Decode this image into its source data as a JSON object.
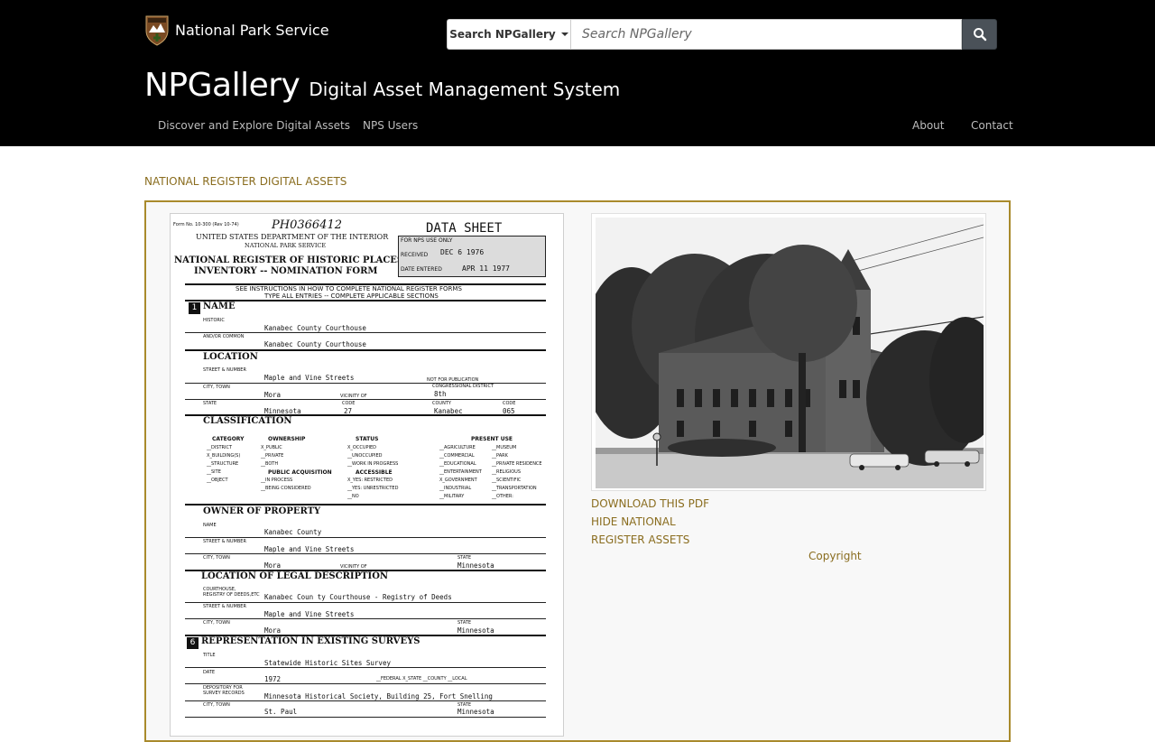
{
  "brand": {
    "name": "National Park Service",
    "logo_icon": "nps-arrowhead-icon"
  },
  "search": {
    "dropdown_label": "Search NPGallery",
    "placeholder": "Search NPGallery",
    "button_icon": "search-icon"
  },
  "site": {
    "title": "NPGallery",
    "subtitle": "Digital Asset Management System"
  },
  "nav": {
    "left": [
      "Discover and Explore Digital Assets",
      "NPS Users"
    ],
    "right": [
      "About",
      "Contact"
    ]
  },
  "breadcrumb": "NATIONAL REGISTER DIGITAL ASSETS",
  "document": {
    "form_no": "Form No. 10-300 (Rev 10-74)",
    "handwritten_id": "PH0366412",
    "data_sheet": "DATA SHEET",
    "dept": "UNITED STATES DEPARTMENT OF THE INTERIOR",
    "service": "NATIONAL PARK SERVICE",
    "form_title_1": "NATIONAL REGISTER OF HISTORIC PLACES",
    "form_title_2": "INVENTORY -- NOMINATION FORM",
    "nps_use": "FOR NPS USE ONLY",
    "received_label": "RECEIVED",
    "received_value": "DEC 6 1976",
    "entered_label": "DATE ENTERED",
    "entered_value": "APR 11 1977",
    "instructions_1": "SEE INSTRUCTIONS IN HOW TO COMPLETE NATIONAL REGISTER FORMS",
    "instructions_2": "TYPE ALL ENTRIES -- COMPLETE APPLICABLE SECTIONS",
    "s1_num": "1",
    "s1_title": "NAME",
    "historic_label": "HISTORIC",
    "historic_value": "Kanabec County Courthouse",
    "common_label": "AND/OR COMMON",
    "common_value": "Kanabec County Courthouse",
    "s2_title": "LOCATION",
    "street_label": "STREET & NUMBER",
    "street_value": "Maple and Vine Streets",
    "not_for_pub": "NOT FOR PUBLICATION",
    "city_label": "CITY, TOWN",
    "city_value": "Mora",
    "vicinity_label": "VICINITY OF",
    "cong_label": "CONGRESSIONAL DISTRICT",
    "cong_value": "8th",
    "state_label": "STATE",
    "state_value": "Minnesota",
    "code_label": "CODE",
    "state_code": "27",
    "county_label": "COUNTY",
    "county_value": "Kanabec",
    "county_code": "065",
    "s3_title": "CLASSIFICATION",
    "category_h": "CATEGORY",
    "ownership_h": "OWNERSHIP",
    "status_h": "STATUS",
    "present_use_h": "PRESENT USE",
    "category_items": [
      "__DISTRICT",
      "X_BUILDING(S)",
      "__STRUCTURE",
      "__SITE",
      "__OBJECT"
    ],
    "ownership_items": [
      "X_PUBLIC",
      "__PRIVATE",
      "__BOTH"
    ],
    "pub_acq_h": "PUBLIC ACQUISITION",
    "pub_acq_items": [
      "__IN PROCESS",
      "__BEING CONSIDERED"
    ],
    "status_items": [
      "X_OCCUPIED",
      "__UNOCCUPIED",
      "__WORK IN PROGRESS"
    ],
    "accessible_h": "ACCESSIBLE",
    "accessible_items": [
      "X_YES: RESTRICTED",
      "__YES: UNRESTRICTED",
      "__NO"
    ],
    "use_col1": [
      "__AGRICULTURE",
      "__COMMERCIAL",
      "__EDUCATIONAL",
      "__ENTERTAINMENT",
      "X_GOVERNMENT",
      "__INDUSTRIAL",
      "__MILITARY"
    ],
    "use_col2": [
      "__MUSEUM",
      "__PARK",
      "__PRIVATE RESIDENCE",
      "__RELIGIOUS",
      "__SCIENTIFIC",
      "__TRANSPORTATION",
      "__OTHER:"
    ],
    "s4_title": "OWNER OF PROPERTY",
    "name_label": "NAME",
    "owner_name": "Kanabec County",
    "owner_street": "Maple and Vine Streets",
    "owner_city": "Mora",
    "owner_state": "Minnesota",
    "s5_title": "LOCATION OF LEGAL DESCRIPTION",
    "courthouse_label_1": "COURTHOUSE,",
    "courthouse_label_2": "REGISTRY OF DEEDS,ETC",
    "courthouse_value": "Kanabec Coun ty Courthouse - Registry of Deeds",
    "legal_street": "Maple and Vine Streets",
    "legal_city": "Mora",
    "legal_state": "Minnesota",
    "s6_num": "6",
    "s6_title": "REPRESENTATION IN EXISTING SURVEYS",
    "title_label": "TITLE",
    "survey_title": "Statewide Historic Sites Survey",
    "date_label": "DATE",
    "survey_date": "1972",
    "survey_level": "__FEDERAL X_STATE __COUNTY __LOCAL",
    "depository_label_1": "DEPOSITORY FOR",
    "depository_label_2": "SURVEY RECORDS",
    "depository_value": "Minnesota Historical Society, Building 25, Fort Snelling",
    "survey_city": "St. Paul",
    "survey_state": "Minnesota"
  },
  "links": {
    "download": "DOWNLOAD THIS PDF",
    "hide_1": "HIDE NATIONAL",
    "hide_2": "REGISTER ASSETS"
  },
  "copyright": "Copyright",
  "colors": {
    "header_bg": "#000000",
    "accent_gold": "#8a6d1f",
    "panel_border": "#a98a2c",
    "search_btn": "#4a5158"
  }
}
